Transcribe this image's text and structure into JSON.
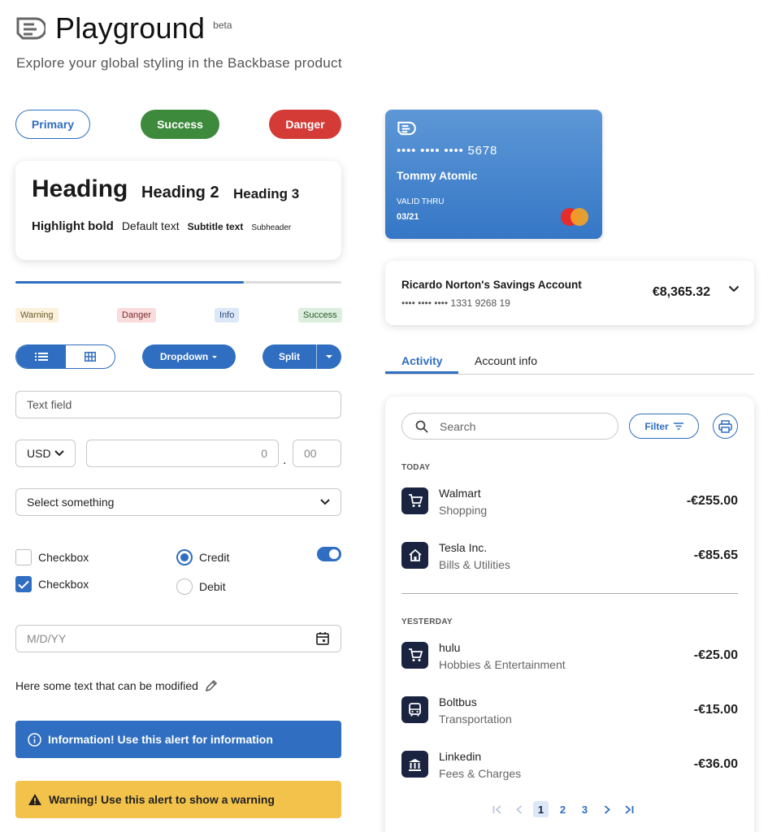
{
  "header": {
    "title": "Playground",
    "badge": "beta",
    "subtitle": "Explore your global styling in the Backbase product"
  },
  "buttons": {
    "primary": "Primary",
    "success": "Success",
    "danger": "Danger"
  },
  "typography": {
    "heading1": "Heading",
    "heading2": "Heading 2",
    "heading3": "Heading 3",
    "highlight": "Highlight bold",
    "default": "Default text",
    "subtitle": "Subtitle text",
    "subheader": "Subheader"
  },
  "progress": {
    "value": 0.7
  },
  "badges": {
    "warning": "Warning",
    "danger": "Danger",
    "info": "Info",
    "success": "Success"
  },
  "controls": {
    "dropdown": "Dropdown",
    "split": "Split"
  },
  "form": {
    "text_placeholder": "Text field",
    "currency": "USD",
    "amount": "0",
    "decimal_sep": ".",
    "decimals": "00",
    "select_placeholder": "Select something",
    "checkbox1": "Checkbox",
    "checkbox2": "Checkbox",
    "checkbox1_checked": false,
    "checkbox2_checked": true,
    "radio_credit": "Credit",
    "radio_debit": "Debit",
    "radio_selected": "Credit",
    "switch_on": true,
    "date_placeholder": "M/D/YY",
    "editable_text": "Here some text that can be modified"
  },
  "alerts": {
    "info": "Information! Use this alert for information",
    "warning": "Warning! Use this alert to show a warning"
  },
  "card": {
    "number": "•••• •••• •••• 5678",
    "holder": "Tommy Atomic",
    "valid_label": "VALID THRU",
    "expiry": "03/21"
  },
  "account": {
    "name": "Ricardo Norton's Savings Account",
    "number": "•••• •••• •••• 1331 9268 19",
    "balance": "€8,365.32"
  },
  "tabs": [
    "Activity",
    "Account info"
  ],
  "transactions": {
    "search_placeholder": "Search",
    "filter_label": "Filter",
    "groups": [
      {
        "label": "TODAY",
        "items": [
          {
            "name": "Walmart",
            "category": "Shopping",
            "amount": "-€255.00",
            "icon": "cart-icon"
          },
          {
            "name": "Tesla Inc.",
            "category": "Bills & Utilities",
            "amount": "-€85.65",
            "icon": "home-icon"
          }
        ]
      },
      {
        "label": "YESTERDAY",
        "items": [
          {
            "name": "hulu",
            "category": "Hobbies & Entertainment",
            "amount": "-€25.00",
            "icon": "cart-icon"
          },
          {
            "name": "Boltbus",
            "category": "Transportation",
            "amount": "-€15.00",
            "icon": "bus-icon"
          },
          {
            "name": "Linkedin",
            "category": "Fees & Charges",
            "amount": "-€36.00",
            "icon": "bank-icon"
          }
        ]
      }
    ],
    "pages": [
      "1",
      "2",
      "3"
    ],
    "current_page": "1"
  },
  "colors": {
    "primary": "#2f6ec0",
    "success": "#3d8a3c",
    "danger": "#d43b37",
    "warning": "#f2c24b",
    "dark": "#1a2440"
  }
}
